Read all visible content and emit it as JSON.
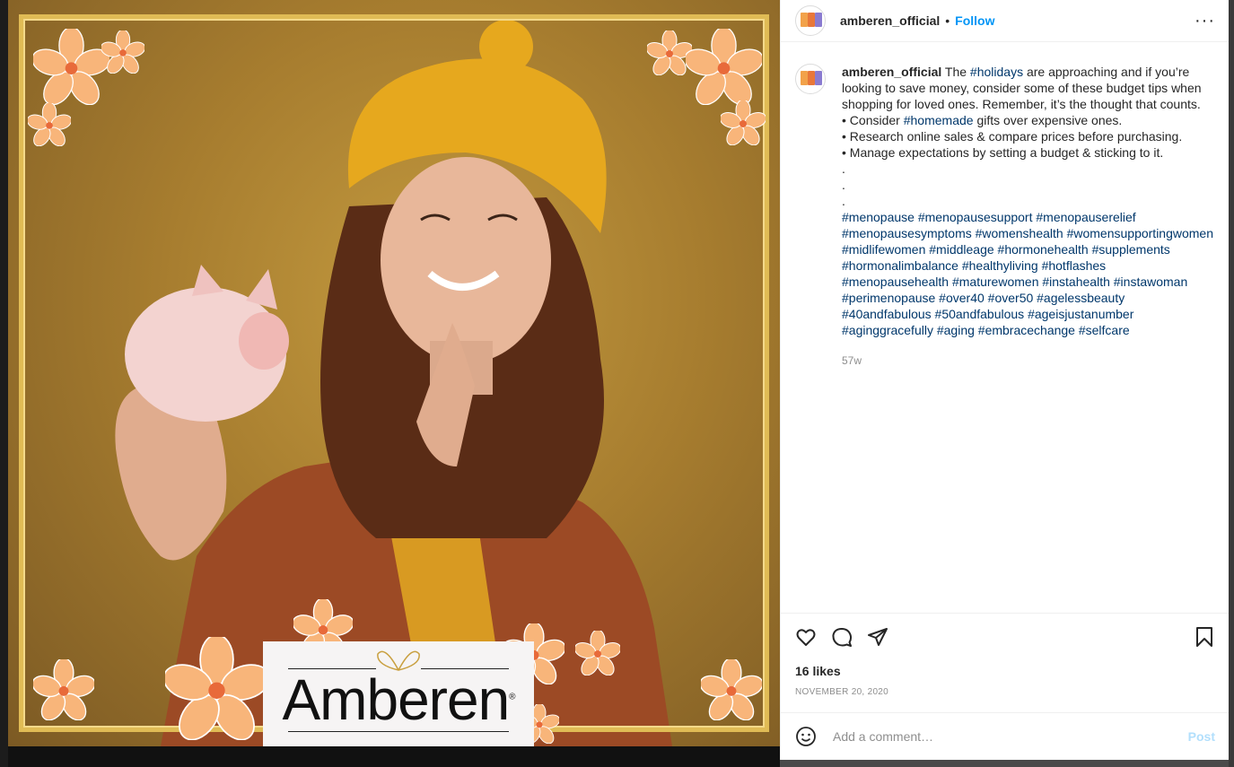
{
  "post": {
    "username": "amberen_official",
    "follow_label": "Follow",
    "dot": "•",
    "more_label": "···",
    "time_ago": "57w",
    "likes": "16 likes",
    "date": "NOVEMBER 20, 2020"
  },
  "image": {
    "logo_text": "Amberen",
    "registered_mark": "®"
  },
  "caption": {
    "username": "amberen_official",
    "intro_before": "The",
    "intro_tag": "#holidays",
    "intro_after": "are approaching and if you’re looking to save money, consider some of these budget tips when shopping for loved ones. Remember, it’s the thought that counts.",
    "bullet1_before": "• Consider",
    "bullet1_tag": "#homemade",
    "bullet1_after": "gifts over expensive ones.",
    "bullet2": "• Research online sales & compare prices before purchasing.",
    "bullet3": "• Manage expectations by setting a budget & sticking to it.",
    "dots": [
      ".",
      ".",
      "."
    ],
    "hashtags": "#menopause #menopausesupport #menopauserelief #menopausesymptoms #womenshealth #womensupportingwomen #midlifewomen #middleage #hormonehealth #supplements #hormonalimbalance #healthyliving #hotflashes #menopausehealth #maturewomen #instahealth #instawoman #perimenopause #over40 #over50 #agelessbeauty #40andfabulous #50andfabulous #ageisjustanumber #aginggracefully #aging #embracechange #selfcare"
  },
  "comment": {
    "placeholder": "Add a comment…",
    "post_label": "Post"
  },
  "icons": {
    "like": "heart-icon",
    "comment": "comment-bubble-icon",
    "share": "paper-plane-icon",
    "save": "bookmark-icon",
    "emoji": "emoji-icon",
    "more": "ellipsis-icon"
  },
  "colors": {
    "link": "#0095f6",
    "hashtag": "#00376b",
    "post_disabled": "#b2dffc",
    "frame_gold": "#e0bb55",
    "photo_bg": "#a77d2f"
  }
}
